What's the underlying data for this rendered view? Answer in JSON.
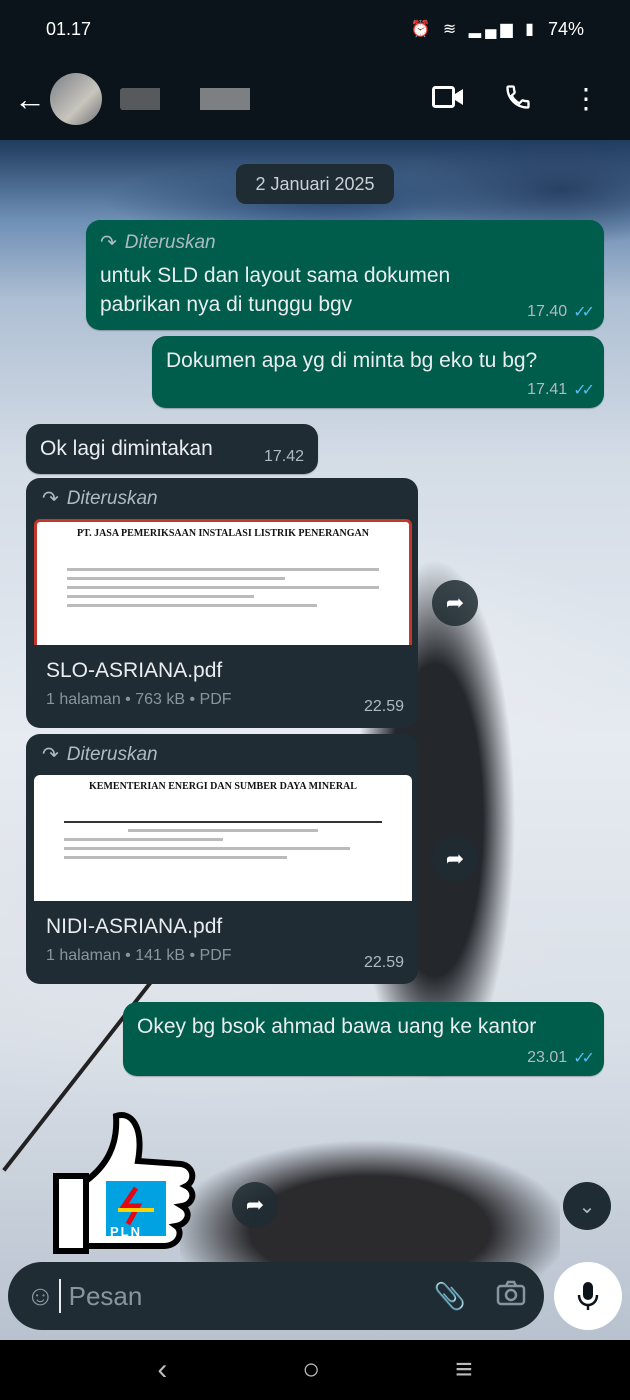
{
  "status_bar": {
    "time": "01.17",
    "battery": "74%"
  },
  "header": {
    "contact_name": ""
  },
  "chat": {
    "date_chip": "2 Januari 2025",
    "messages": [
      {
        "forwarded_label": "Diteruskan",
        "text": "untuk SLD dan layout sama dokumen pabrikan nya di tunggu bgv",
        "time": "17.40"
      },
      {
        "text": "Dokumen apa yg di minta bg eko tu bg?",
        "time": "17.41"
      },
      {
        "text": "Ok lagi dimintakan",
        "time": "17.42"
      },
      {
        "text": "Okey bg bsok ahmad bawa uang ke kantor",
        "time": "23.01"
      }
    ],
    "documents": [
      {
        "forwarded_label": "Diteruskan",
        "thumb_title": "PT. JASA PEMERIKSAAN INSTALASI LISTRIK PENERANGAN",
        "name": "SLO-ASRIANA.pdf",
        "info": "1 halaman • 763 kB • PDF",
        "time": "22.59"
      },
      {
        "forwarded_label": "Diteruskan",
        "thumb_title": "KEMENTERIAN ENERGI DAN SUMBER DAYA MINERAL",
        "name": "NIDI-ASRIANA.pdf",
        "info": "1 halaman • 141 kB • PDF",
        "time": "22.59"
      }
    ],
    "sticker_text": "PLN"
  },
  "input": {
    "placeholder": "Pesan"
  },
  "icons": {
    "back": "arrow-left-icon",
    "video": "video-call-icon",
    "call": "phone-icon",
    "menu": "more-vertical-icon",
    "emoji": "sticker-icon",
    "attach": "paperclip-icon",
    "camera": "camera-icon",
    "mic": "microphone-icon"
  },
  "colors": {
    "outgoing_bubble": "#005c4b",
    "incoming_bubble": "#202c33",
    "read_ticks": "#53bdeb",
    "background": "#0b141a"
  }
}
